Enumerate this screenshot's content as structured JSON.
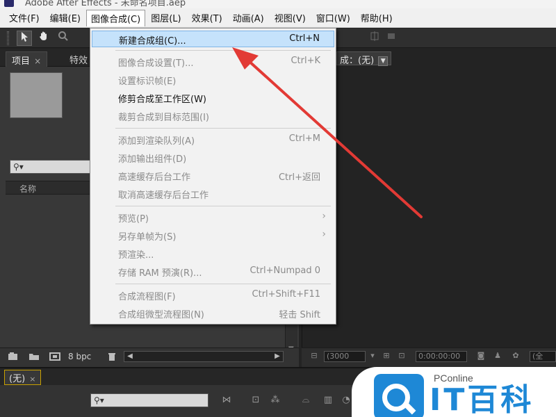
{
  "window": {
    "title": "Adobe After Effects - 未命名项目.aep"
  },
  "menubar": {
    "items": [
      {
        "label": "文件(F)"
      },
      {
        "label": "编辑(E)"
      },
      {
        "label": "图像合成(C)"
      },
      {
        "label": "图层(L)"
      },
      {
        "label": "效果(T)"
      },
      {
        "label": "动画(A)"
      },
      {
        "label": "视图(V)"
      },
      {
        "label": "窗口(W)"
      },
      {
        "label": "帮助(H)"
      }
    ],
    "active_index": 2
  },
  "toolbar": {
    "icons": [
      "selection-tool-icon",
      "hand-tool-icon",
      "zoom-tool-icon"
    ]
  },
  "project_panel": {
    "tabs": [
      {
        "label": "项目"
      },
      {
        "label": "特效"
      }
    ],
    "close_glyph": "×",
    "search_glyph": "⚲▾",
    "column_name": "名称",
    "bit_depth": "8 bpc"
  },
  "composition_panel": {
    "tab_label": "成：(无)",
    "zoom_value": "(3000",
    "timecode": "0:00:00:00",
    "resolution": "(全"
  },
  "timeline": {
    "tab_label": "(无)",
    "search_glyph": "⚲▾"
  },
  "dropdown": {
    "items": [
      {
        "label": "新建合成组(C)...",
        "shortcut": "Ctrl+N",
        "state": "highlight"
      },
      {
        "type": "separator"
      },
      {
        "label": "图像合成设置(T)...",
        "shortcut": "Ctrl+K",
        "state": "disabled"
      },
      {
        "label": "设置标识帧(E)",
        "shortcut": "",
        "state": "disabled"
      },
      {
        "label": "修剪合成至工作区(W)",
        "shortcut": "",
        "state": "enabled"
      },
      {
        "label": "裁剪合成到目标范围(I)",
        "shortcut": "",
        "state": "disabled"
      },
      {
        "type": "separator"
      },
      {
        "label": "添加到渲染队列(A)",
        "shortcut": "Ctrl+M",
        "state": "disabled"
      },
      {
        "label": "添加输出组件(D)",
        "shortcut": "",
        "state": "disabled"
      },
      {
        "label": "高速缓存后台工作",
        "shortcut": "Ctrl+返回",
        "state": "disabled"
      },
      {
        "label": "取消高速缓存后台工作",
        "shortcut": "",
        "state": "disabled"
      },
      {
        "type": "separator"
      },
      {
        "label": "预览(P)",
        "shortcut": "",
        "state": "disabled",
        "submenu": true
      },
      {
        "label": "另存单帧为(S)",
        "shortcut": "",
        "state": "disabled",
        "submenu": true
      },
      {
        "label": "预渲染...",
        "shortcut": "",
        "state": "disabled"
      },
      {
        "label": "存储 RAM 预演(R)...",
        "shortcut": "Ctrl+Numpad 0",
        "state": "disabled"
      },
      {
        "type": "separator"
      },
      {
        "label": "合成流程图(F)",
        "shortcut": "Ctrl+Shift+F11",
        "state": "disabled"
      },
      {
        "label": "合成组微型流程图(N)",
        "shortcut": "轻击 Shift",
        "state": "disabled"
      }
    ],
    "submenu_glyph": "›"
  },
  "watermark": {
    "brand": "PConline",
    "title": "IT百科"
  },
  "colors": {
    "highlight": "#c5e2fb",
    "annotation_arrow": "#e23a35",
    "watermark_blue": "#1e88d6"
  }
}
